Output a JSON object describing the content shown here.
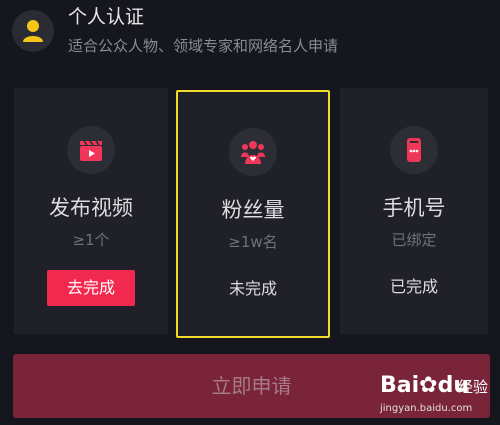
{
  "header": {
    "title": "个人认证",
    "subtitle": "适合公众人物、领域专家和网络名人申请",
    "icon": "user-avatar-icon"
  },
  "cards": [
    {
      "icon": "video-clapper-icon",
      "title": "发布视频",
      "requirement": "≥1个",
      "action_label": "去完成",
      "status": ""
    },
    {
      "icon": "fans-group-icon",
      "title": "粉丝量",
      "requirement": "≥1w名",
      "action_label": "",
      "status": "未完成"
    },
    {
      "icon": "phone-icon",
      "title": "手机号",
      "requirement": "已绑定",
      "action_label": "",
      "status": "已完成"
    }
  ],
  "apply_button": {
    "label": "立即申请"
  },
  "watermark": {
    "logo_left": "Bai",
    "logo_right": "du",
    "logo_sub": "经验",
    "url": "jingyan.baidu.com"
  },
  "colors": {
    "background": "#15161e",
    "card": "#1f2028",
    "accent_red": "#f2294f",
    "highlight_border": "#f2db2c",
    "apply_button": "#7a2439",
    "icon_accent": "#f0375a"
  }
}
